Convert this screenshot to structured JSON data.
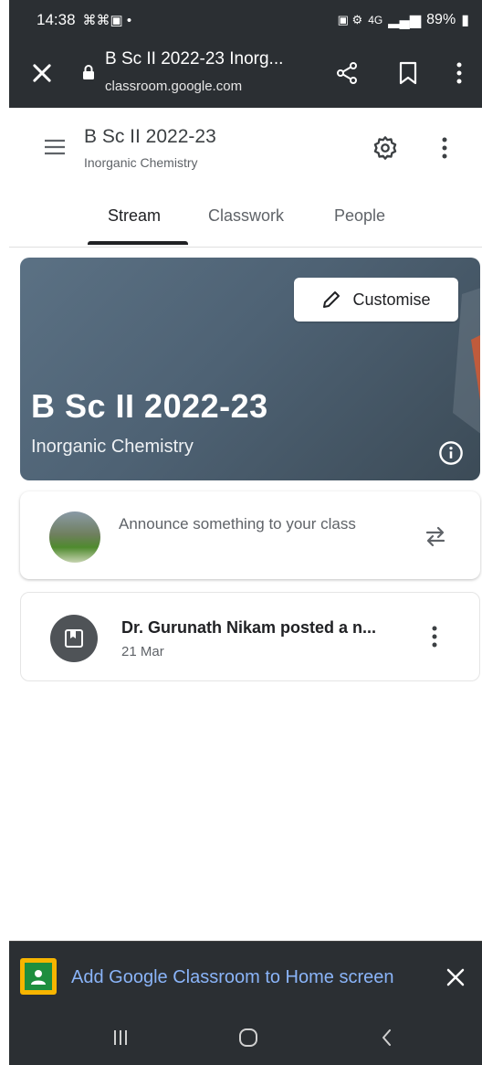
{
  "status_bar": {
    "time": "14:38",
    "left_icons": "⌘⌘▣ •",
    "signal_text": "4G",
    "battery": "89%"
  },
  "browser": {
    "tab_title": "B Sc II 2022-23 Inorg...",
    "url": "classroom.google.com",
    "icons": [
      "close-icon",
      "lock-icon",
      "share-icon",
      "bookmark-icon",
      "more-vert-icon"
    ]
  },
  "header": {
    "course_title": "B Sc II 2022-23",
    "course_subject": "Inorganic Chemistry",
    "tabs": [
      {
        "label": "Stream",
        "active": true
      },
      {
        "label": "Classwork",
        "active": false
      },
      {
        "label": "People",
        "active": false
      }
    ]
  },
  "banner": {
    "customise_label": "Customise",
    "title": "B Sc II 2022-23",
    "subtitle": "Inorganic Chemistry"
  },
  "announce": {
    "placeholder": "Announce something to your class"
  },
  "post": {
    "title": "Dr. Gurunath Nikam posted a n...",
    "date": "21 Mar"
  },
  "install_banner": {
    "text": "Add Google Classroom to Home screen"
  },
  "colors": {
    "dark_bar": "#2b2f33",
    "banner_blue": "#4e6274",
    "link_blue": "#8ab4f8",
    "classroom_yellow": "#f7b500",
    "classroom_green": "#1e8e3e"
  }
}
